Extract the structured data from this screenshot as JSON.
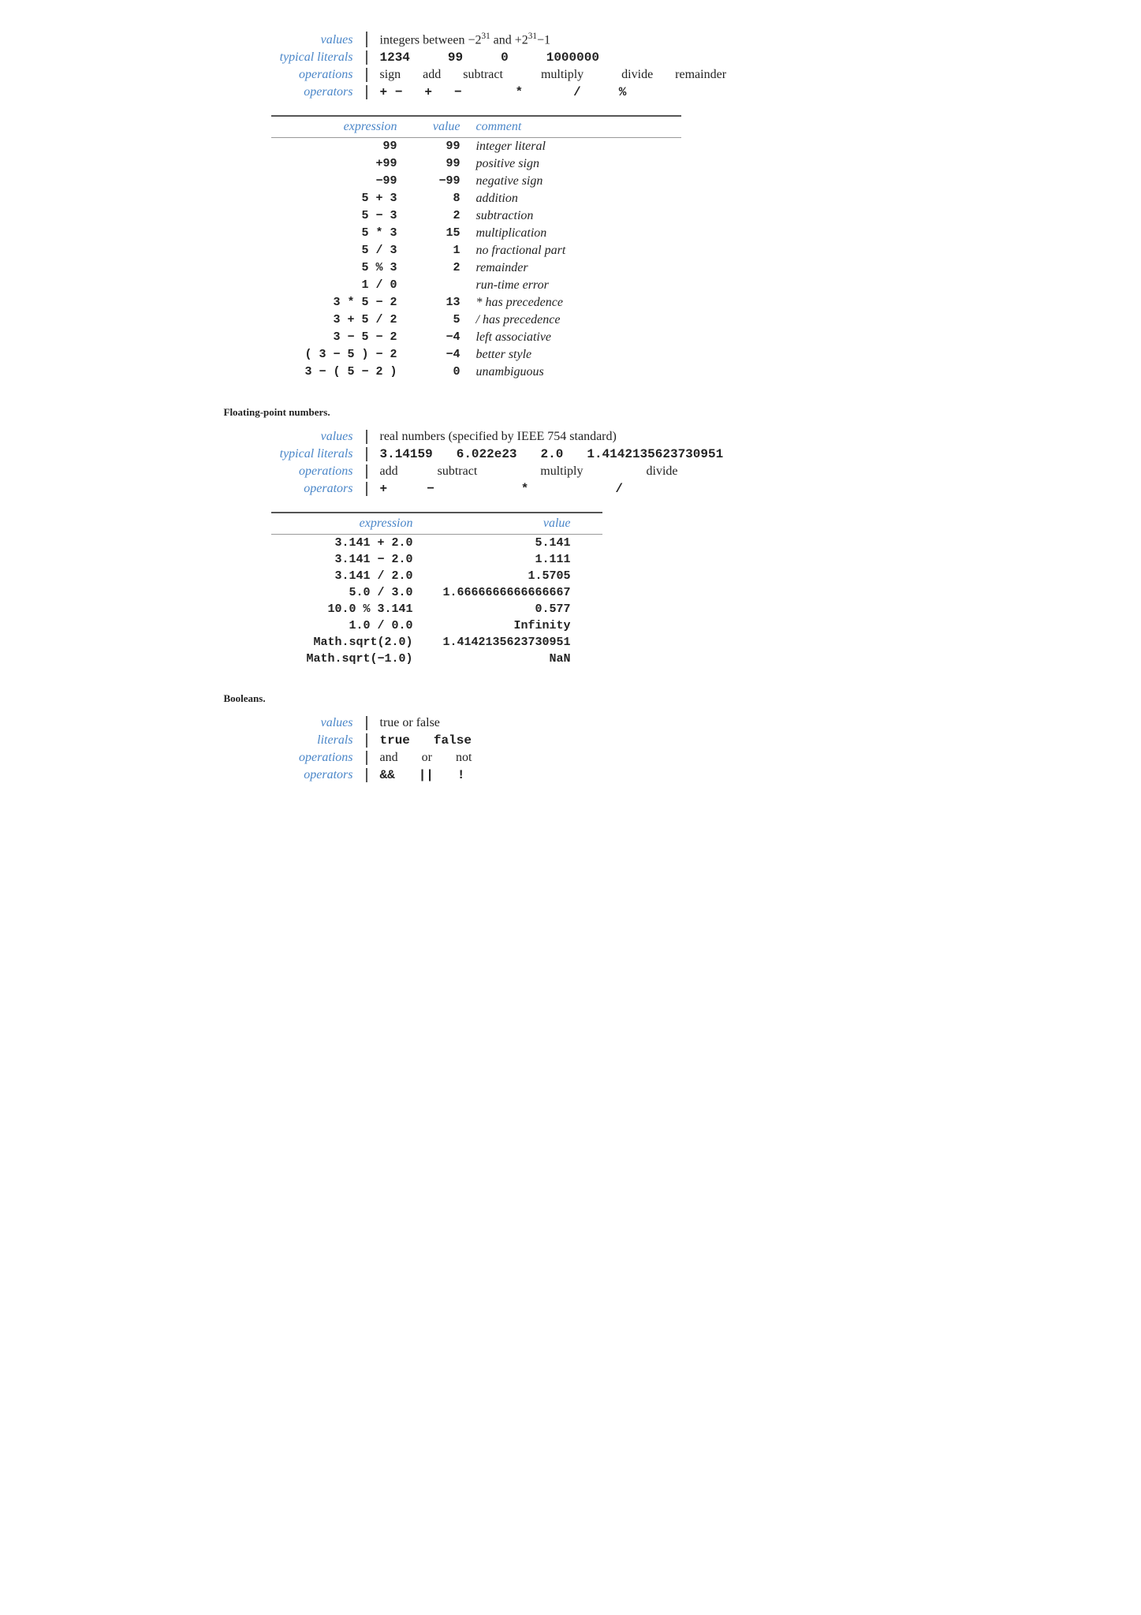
{
  "integers": {
    "title": "integers between −2³¹ and +2³¹−1",
    "properties": [
      {
        "label": "values",
        "values": [
          "integers between −2³¹ and +2³¹−1"
        ]
      },
      {
        "label": "typical literals",
        "values": [
          "1234",
          "99",
          "0",
          "1000000"
        ]
      },
      {
        "label": "operations",
        "values": [
          "sign",
          "add",
          "subtract",
          "multiply",
          "divide",
          "remainder"
        ]
      },
      {
        "label": "operators",
        "values": [
          "+ −",
          "+",
          "−",
          "*",
          "/",
          "%"
        ]
      }
    ],
    "expr_headers": [
      "expression",
      "value",
      "comment"
    ],
    "expressions": [
      {
        "expr": "99",
        "val": "99",
        "comment": "integer literal"
      },
      {
        "expr": "+99",
        "val": "99",
        "comment": "positive sign"
      },
      {
        "expr": "−99",
        "val": "−99",
        "comment": "negative sign"
      },
      {
        "expr": "5 + 3",
        "val": "8",
        "comment": "addition"
      },
      {
        "expr": "5 − 3",
        "val": "2",
        "comment": "subtraction"
      },
      {
        "expr": "5 * 3",
        "val": "15",
        "comment": "multiplication"
      },
      {
        "expr": "5 / 3",
        "val": "1",
        "comment": "no fractional part"
      },
      {
        "expr": "5 % 3",
        "val": "2",
        "comment": "remainder"
      },
      {
        "expr": "1 / 0",
        "val": "",
        "comment": "run-time error"
      },
      {
        "expr": "3 * 5 − 2",
        "val": "13",
        "comment": "* has precedence"
      },
      {
        "expr": "3 + 5 / 2",
        "val": "5",
        "comment": "/ has precedence"
      },
      {
        "expr": "3 − 5 − 2",
        "val": "−4",
        "comment": "left associative"
      },
      {
        "expr": "( 3 − 5 ) − 2",
        "val": "−4",
        "comment": "better style"
      },
      {
        "expr": "3 − ( 5 − 2 )",
        "val": "0",
        "comment": "unambiguous"
      }
    ]
  },
  "section_labels": {
    "floats": "Floating-point numbers.",
    "booleans": "Booleans."
  },
  "floats": {
    "properties": [
      {
        "label": "values",
        "values": [
          "real numbers (specified by IEEE 754 standard)"
        ]
      },
      {
        "label": "typical literals",
        "values": [
          "3.14159",
          "6.022e23",
          "2.0",
          "1.4142135623730951"
        ]
      },
      {
        "label": "operations",
        "values": [
          "add",
          "subtract",
          "multiply",
          "divide"
        ]
      },
      {
        "label": "operators",
        "values": [
          "+",
          "−",
          "*",
          "/"
        ]
      }
    ],
    "expr_headers": [
      "expression",
      "value"
    ],
    "expressions": [
      {
        "expr": "3.141 + 2.0",
        "val": "5.141"
      },
      {
        "expr": "3.141 − 2.0",
        "val": "1.111"
      },
      {
        "expr": "3.141 / 2.0",
        "val": "1.5705"
      },
      {
        "expr": "5.0 / 3.0",
        "val": "1.6666666666666667"
      },
      {
        "expr": "10.0 % 3.141",
        "val": "0.577"
      },
      {
        "expr": "1.0 / 0.0",
        "val": "Infinity"
      },
      {
        "expr": "Math.sqrt(2.0)",
        "val": "1.4142135623730951"
      },
      {
        "expr": "Math.sqrt(−1.0)",
        "val": "NaN"
      }
    ]
  },
  "booleans": {
    "properties": [
      {
        "label": "values",
        "values": [
          "true or false"
        ]
      },
      {
        "label": "literals",
        "values": [
          "true",
          "false"
        ]
      },
      {
        "label": "operations",
        "values": [
          "and",
          "or",
          "not"
        ]
      },
      {
        "label": "operators",
        "values": [
          "&&",
          "||",
          "!"
        ]
      }
    ]
  }
}
